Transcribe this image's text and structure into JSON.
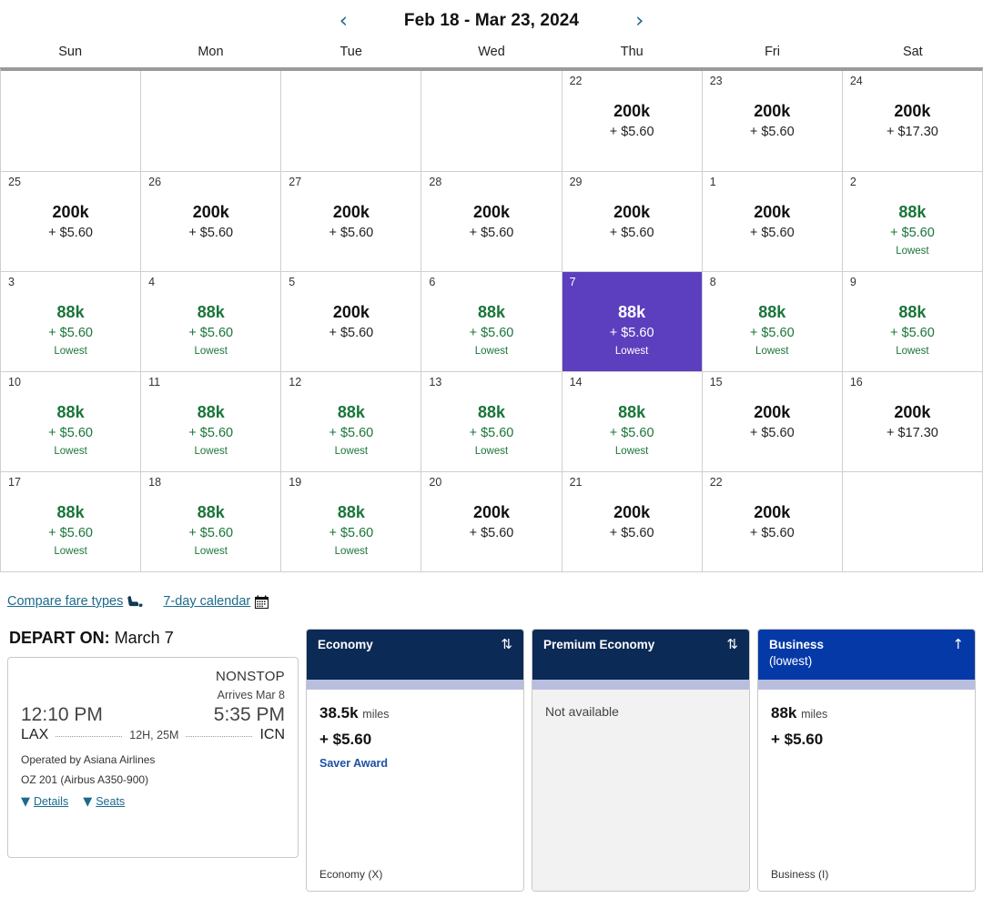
{
  "calendar": {
    "prev_label": "‹",
    "next_label": "›",
    "range": "Feb 18 - Mar 23, 2024",
    "weekdays": [
      "Sun",
      "Mon",
      "Tue",
      "Wed",
      "Thu",
      "Fri",
      "Sat"
    ],
    "lowest_label": "Lowest",
    "weeks": [
      [
        {
          "day": "",
          "empty": true
        },
        {
          "day": "",
          "empty": true
        },
        {
          "day": "",
          "empty": true
        },
        {
          "day": "",
          "empty": true
        },
        {
          "day": "22",
          "miles": "200k",
          "tax": "+ $5.60",
          "lowest": "",
          "low": false
        },
        {
          "day": "23",
          "miles": "200k",
          "tax": "+ $5.60",
          "lowest": "",
          "low": false
        },
        {
          "day": "24",
          "miles": "200k",
          "tax": "+ $17.30",
          "lowest": "",
          "low": false
        }
      ],
      [
        {
          "day": "25",
          "miles": "200k",
          "tax": "+ $5.60",
          "lowest": "",
          "low": false
        },
        {
          "day": "26",
          "miles": "200k",
          "tax": "+ $5.60",
          "lowest": "",
          "low": false
        },
        {
          "day": "27",
          "miles": "200k",
          "tax": "+ $5.60",
          "lowest": "",
          "low": false
        },
        {
          "day": "28",
          "miles": "200k",
          "tax": "+ $5.60",
          "lowest": "",
          "low": false
        },
        {
          "day": "29",
          "miles": "200k",
          "tax": "+ $5.60",
          "lowest": "",
          "low": false
        },
        {
          "day": "1",
          "miles": "200k",
          "tax": "+ $5.60",
          "lowest": "",
          "low": false
        },
        {
          "day": "2",
          "miles": "88k",
          "tax": "+ $5.60",
          "lowest": "Lowest",
          "low": true
        }
      ],
      [
        {
          "day": "3",
          "miles": "88k",
          "tax": "+ $5.60",
          "lowest": "Lowest",
          "low": true
        },
        {
          "day": "4",
          "miles": "88k",
          "tax": "+ $5.60",
          "lowest": "Lowest",
          "low": true
        },
        {
          "day": "5",
          "miles": "200k",
          "tax": "+ $5.60",
          "lowest": "",
          "low": false
        },
        {
          "day": "6",
          "miles": "88k",
          "tax": "+ $5.60",
          "lowest": "Lowest",
          "low": true
        },
        {
          "day": "7",
          "miles": "88k",
          "tax": "+ $5.60",
          "lowest": "Lowest",
          "low": true,
          "selected": true
        },
        {
          "day": "8",
          "miles": "88k",
          "tax": "+ $5.60",
          "lowest": "Lowest",
          "low": true
        },
        {
          "day": "9",
          "miles": "88k",
          "tax": "+ $5.60",
          "lowest": "Lowest",
          "low": true
        }
      ],
      [
        {
          "day": "10",
          "miles": "88k",
          "tax": "+ $5.60",
          "lowest": "Lowest",
          "low": true
        },
        {
          "day": "11",
          "miles": "88k",
          "tax": "+ $5.60",
          "lowest": "Lowest",
          "low": true
        },
        {
          "day": "12",
          "miles": "88k",
          "tax": "+ $5.60",
          "lowest": "Lowest",
          "low": true
        },
        {
          "day": "13",
          "miles": "88k",
          "tax": "+ $5.60",
          "lowest": "Lowest",
          "low": true
        },
        {
          "day": "14",
          "miles": "88k",
          "tax": "+ $5.60",
          "lowest": "Lowest",
          "low": true
        },
        {
          "day": "15",
          "miles": "200k",
          "tax": "+ $5.60",
          "lowest": "",
          "low": false
        },
        {
          "day": "16",
          "miles": "200k",
          "tax": "+ $17.30",
          "lowest": "",
          "low": false
        }
      ],
      [
        {
          "day": "17",
          "miles": "88k",
          "tax": "+ $5.60",
          "lowest": "Lowest",
          "low": true
        },
        {
          "day": "18",
          "miles": "88k",
          "tax": "+ $5.60",
          "lowest": "Lowest",
          "low": true
        },
        {
          "day": "19",
          "miles": "88k",
          "tax": "+ $5.60",
          "lowest": "Lowest",
          "low": true
        },
        {
          "day": "20",
          "miles": "200k",
          "tax": "+ $5.60",
          "lowest": "",
          "low": false
        },
        {
          "day": "21",
          "miles": "200k",
          "tax": "+ $5.60",
          "lowest": "",
          "low": false
        },
        {
          "day": "22",
          "miles": "200k",
          "tax": "+ $5.60",
          "lowest": "",
          "low": false
        },
        {
          "day": "",
          "empty": true
        }
      ]
    ],
    "selected_color": "#5c3fbe",
    "lowest_color": "#1a7539"
  },
  "links": {
    "compare_fare_types": "Compare fare types",
    "compare_icon": "seat-icon",
    "seven_day_calendar": "7-day calendar",
    "calendar_icon": "calendar-icon"
  },
  "depart": {
    "label": "DEPART ON:",
    "date": "March 7",
    "flight": {
      "nonstop": "NONSTOP",
      "arrives": "Arrives Mar 8",
      "depart_time": "12:10 PM",
      "arrive_time": "5:35 PM",
      "origin": "LAX",
      "destination": "ICN",
      "duration": "12H, 25M",
      "operated_by": "Operated by Asiana Airlines",
      "flight_number": "OZ 201 (Airbus A350-900)",
      "details_label": "Details",
      "seats_label": "Seats"
    }
  },
  "fares": [
    {
      "name": "Economy",
      "sub": "",
      "sort_icon": "sort-updown-icon",
      "miles": "38.5k",
      "miles_unit": "miles",
      "price": "+ $5.60",
      "award_type": "Saver Award",
      "not_available": "",
      "cabin_code": "Economy (X)",
      "header_color": "#0c2a56",
      "available": true
    },
    {
      "name": "Premium Economy",
      "sub": "",
      "sort_icon": "sort-updown-icon",
      "miles": "",
      "miles_unit": "",
      "price": "",
      "award_type": "",
      "not_available": "Not available",
      "cabin_code": "",
      "header_color": "#0c2a56",
      "available": false
    },
    {
      "name": "Business",
      "sub": "(lowest)",
      "sort_icon": "sort-up-icon",
      "miles": "88k",
      "miles_unit": "miles",
      "price": "+ $5.60",
      "award_type": "",
      "not_available": "",
      "cabin_code": "Business (I)",
      "header_color": "#0639a8",
      "available": true
    }
  ]
}
